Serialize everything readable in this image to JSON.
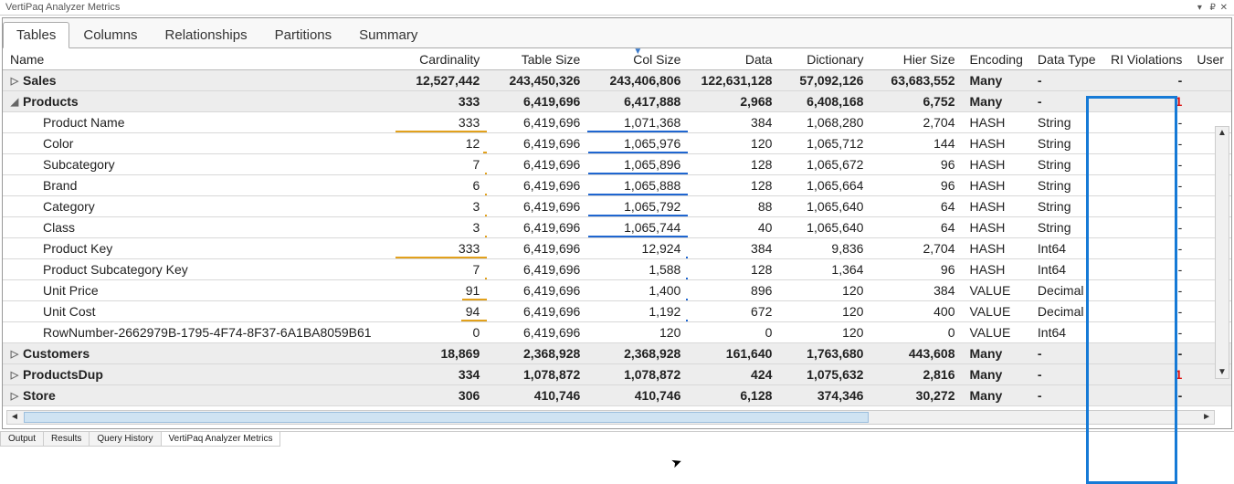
{
  "window": {
    "title": "VertiPaq Analyzer Metrics"
  },
  "tabs": [
    "Tables",
    "Columns",
    "Relationships",
    "Partitions",
    "Summary"
  ],
  "active_tab": 0,
  "headers": {
    "name": "Name",
    "card": "Cardinality",
    "table_size": "Table Size",
    "col_size": "Col Size",
    "data": "Data",
    "dict": "Dictionary",
    "hier": "Hier Size",
    "enc": "Encoding",
    "dtype": "Data Type",
    "ri": "RI Violations",
    "user": "User"
  },
  "rows": [
    {
      "kind": "sum",
      "expand": "right",
      "name": "Sales",
      "card": "12,527,442",
      "ts": "243,450,326",
      "cs": "243,406,806",
      "data": "122,631,128",
      "dict": "57,092,126",
      "hier": "63,683,552",
      "enc": "Many",
      "dt": "-",
      "ri": "-"
    },
    {
      "kind": "sum",
      "expand": "down",
      "name": "Products",
      "card": "333",
      "ts": "6,419,696",
      "cs": "6,417,888",
      "data": "2,968",
      "dict": "6,408,168",
      "hier": "6,752",
      "enc": "Many",
      "dt": "-",
      "ri": "1",
      "riRed": true
    },
    {
      "kind": "det",
      "name": "Product Name",
      "card": "333",
      "ts": "6,419,696",
      "cs": "1,071,368",
      "data": "384",
      "dict": "1,068,280",
      "hier": "2,704",
      "enc": "HASH",
      "dt": "String",
      "ri": "-",
      "barO": 100,
      "barB": 100
    },
    {
      "kind": "det",
      "name": "Color",
      "card": "12",
      "ts": "6,419,696",
      "cs": "1,065,976",
      "data": "120",
      "dict": "1,065,712",
      "hier": "144",
      "enc": "HASH",
      "dt": "String",
      "ri": "-",
      "barO": 4,
      "barB": 99
    },
    {
      "kind": "det",
      "name": "Subcategory",
      "card": "7",
      "ts": "6,419,696",
      "cs": "1,065,896",
      "data": "128",
      "dict": "1,065,672",
      "hier": "96",
      "enc": "HASH",
      "dt": "String",
      "ri": "-",
      "barO": 2,
      "barB": 99
    },
    {
      "kind": "det",
      "name": "Brand",
      "card": "6",
      "ts": "6,419,696",
      "cs": "1,065,888",
      "data": "128",
      "dict": "1,065,664",
      "hier": "96",
      "enc": "HASH",
      "dt": "String",
      "ri": "-",
      "barO": 2,
      "barB": 99
    },
    {
      "kind": "det",
      "name": "Category",
      "card": "3",
      "ts": "6,419,696",
      "cs": "1,065,792",
      "data": "88",
      "dict": "1,065,640",
      "hier": "64",
      "enc": "HASH",
      "dt": "String",
      "ri": "-",
      "barO": 1,
      "barB": 99
    },
    {
      "kind": "det",
      "name": "Class",
      "card": "3",
      "ts": "6,419,696",
      "cs": "1,065,744",
      "data": "40",
      "dict": "1,065,640",
      "hier": "64",
      "enc": "HASH",
      "dt": "String",
      "ri": "-",
      "barO": 1,
      "barB": 99
    },
    {
      "kind": "det",
      "name": "Product Key",
      "card": "333",
      "ts": "6,419,696",
      "cs": "12,924",
      "data": "384",
      "dict": "9,836",
      "hier": "2,704",
      "enc": "HASH",
      "dt": "Int64",
      "ri": "-",
      "barO": 100,
      "barB": 1
    },
    {
      "kind": "det",
      "name": "Product Subcategory Key",
      "card": "7",
      "ts": "6,419,696",
      "cs": "1,588",
      "data": "128",
      "dict": "1,364",
      "hier": "96",
      "enc": "HASH",
      "dt": "Int64",
      "ri": "-",
      "barO": 2,
      "barB": 0.1
    },
    {
      "kind": "det",
      "name": "Unit Price",
      "card": "91",
      "ts": "6,419,696",
      "cs": "1,400",
      "data": "896",
      "dict": "120",
      "hier": "384",
      "enc": "VALUE",
      "dt": "Decimal",
      "ri": "-",
      "barO": 27,
      "barB": 0.1
    },
    {
      "kind": "det",
      "name": "Unit Cost",
      "card": "94",
      "ts": "6,419,696",
      "cs": "1,192",
      "data": "672",
      "dict": "120",
      "hier": "400",
      "enc": "VALUE",
      "dt": "Decimal",
      "ri": "-",
      "barO": 28,
      "barB": 0.1
    },
    {
      "kind": "det",
      "name": "RowNumber-2662979B-1795-4F74-8F37-6A1BA8059B61",
      "card": "0",
      "ts": "6,419,696",
      "cs": "120",
      "data": "0",
      "dict": "120",
      "hier": "0",
      "enc": "VALUE",
      "dt": "Int64",
      "ri": "-"
    },
    {
      "kind": "sum",
      "expand": "right",
      "name": "Customers",
      "card": "18,869",
      "ts": "2,368,928",
      "cs": "2,368,928",
      "data": "161,640",
      "dict": "1,763,680",
      "hier": "443,608",
      "enc": "Many",
      "dt": "-",
      "ri": "-"
    },
    {
      "kind": "sum",
      "expand": "right",
      "name": "ProductsDup",
      "card": "334",
      "ts": "1,078,872",
      "cs": "1,078,872",
      "data": "424",
      "dict": "1,075,632",
      "hier": "2,816",
      "enc": "Many",
      "dt": "-",
      "ri": "1",
      "riRed": true
    },
    {
      "kind": "sum",
      "expand": "right",
      "name": "Store",
      "card": "306",
      "ts": "410,746",
      "cs": "410,746",
      "data": "6,128",
      "dict": "374,346",
      "hier": "30,272",
      "enc": "Many",
      "dt": "-",
      "ri": "-"
    }
  ],
  "bottom_tabs": [
    "Output",
    "Results",
    "Query History",
    "VertiPaq Analyzer Metrics"
  ],
  "active_bottom_tab": 3
}
